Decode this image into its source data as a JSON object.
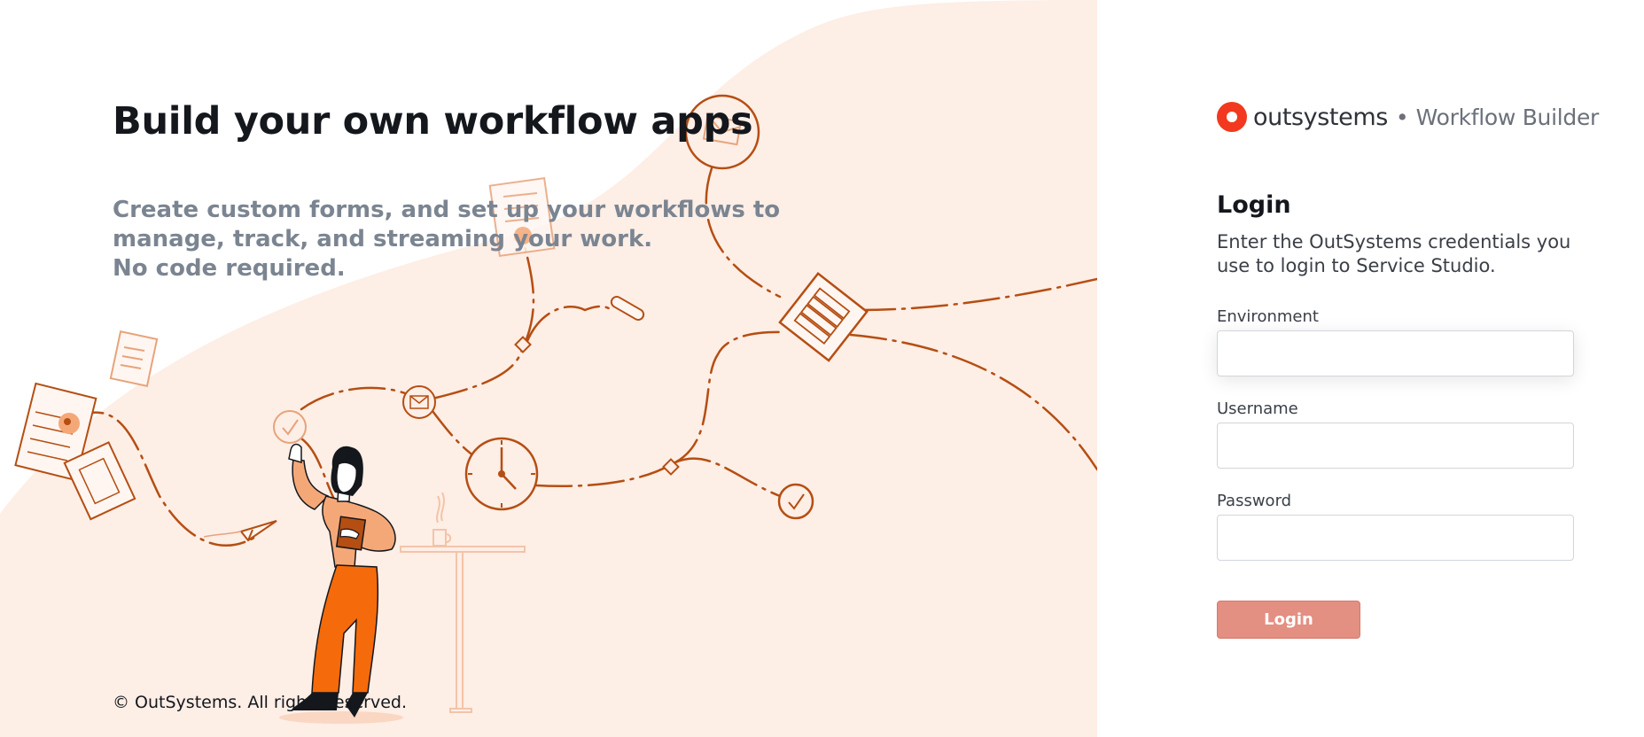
{
  "hero": {
    "title": "Build your own workflow apps",
    "subtitle_lines": [
      "Create custom forms, and set up your workflows to",
      "manage, track, and streaming your work.",
      "No code required."
    ],
    "copyright": "© OutSystems. All rights reserved."
  },
  "brand": {
    "name": "outsystems",
    "separator": "•",
    "product": "Workflow Builder",
    "logo_color": "#f2391f"
  },
  "login": {
    "title": "Login",
    "description": "Enter the OutSystems credentials you use to login to Service Studio.",
    "fields": {
      "environment": {
        "label": "Environment",
        "value": ""
      },
      "username": {
        "label": "Username",
        "value": ""
      },
      "password": {
        "label": "Password",
        "value": ""
      }
    },
    "button_label": "Login"
  },
  "colors": {
    "accent": "#b54e12",
    "illustration_bg": "#fdeee6",
    "button_bg": "#e38f82",
    "person_pants": "#f56a0a",
    "subtitle_text": "#7b8591"
  },
  "illustration_icons": [
    "document-icon",
    "mail-icon",
    "clock-icon",
    "checkmark-icon",
    "paper-plane-icon",
    "diamond-node-icon",
    "coffee-cup-icon",
    "person-illustration"
  ]
}
